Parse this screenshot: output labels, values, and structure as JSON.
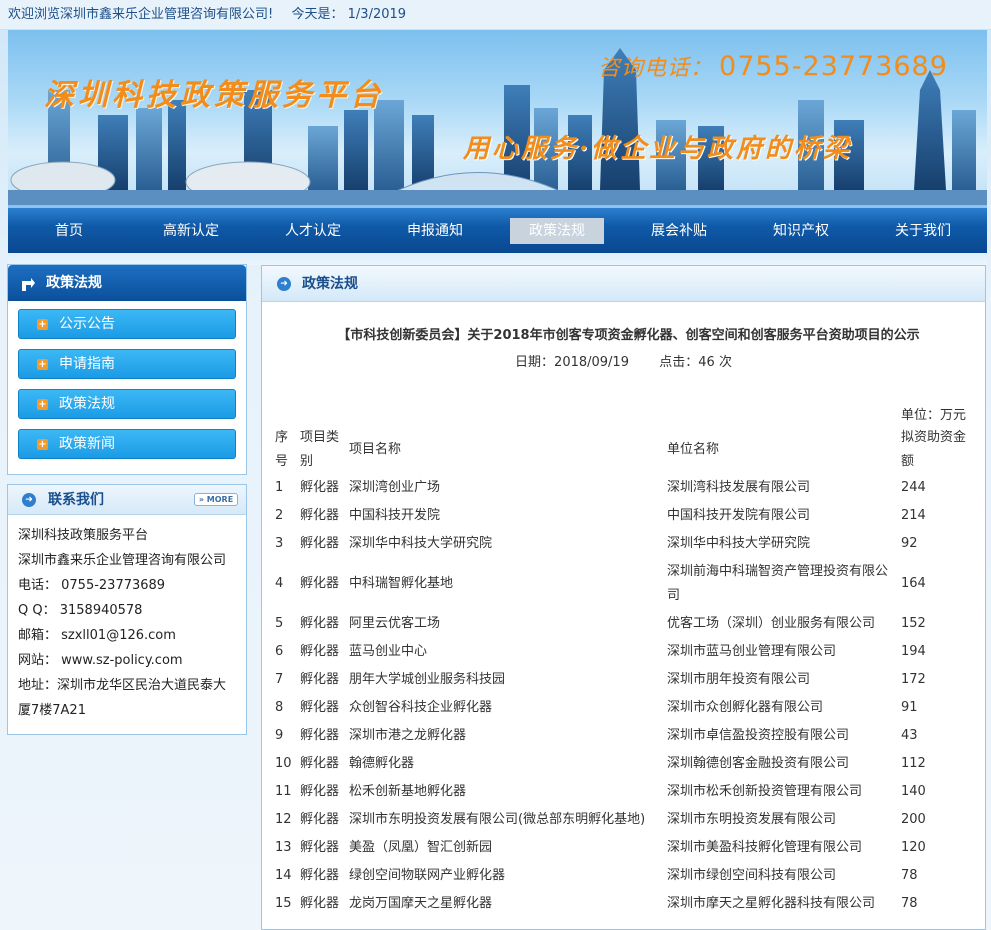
{
  "topbar": {
    "welcome": "欢迎浏览深圳市鑫来乐企业管理咨询有限公司!",
    "today_label": "今天是：",
    "today_value": "1/3/2019"
  },
  "banner": {
    "site_title": "深圳科技政策服务平台",
    "hotline_label": "咨询电话：",
    "hotline_number": "0755-23773689",
    "slogan": "用心服务·做企业与政府的桥梁"
  },
  "nav": {
    "items": [
      "首页",
      "高新认定",
      "人才认定",
      "申报通知",
      "政策法规",
      "展会补贴",
      "知识产权",
      "关于我们"
    ],
    "active": "政策法规"
  },
  "sidebar": {
    "section_title": "政策法规",
    "menu": [
      "公示公告",
      "申请指南",
      "政策法规",
      "政策新闻"
    ],
    "contact_title": "联系我们",
    "more_label": "MORE",
    "contact_lines": [
      "深圳科技政策服务平台",
      "深圳市鑫来乐企业管理咨询有限公司",
      "电话： 0755-23773689",
      "Q Q： 3158940578",
      "邮箱： szxll01@126.com",
      "网站： www.sz-policy.com",
      "地址：深圳市龙华区民治大道民泰大厦7楼7A21"
    ]
  },
  "main": {
    "panel_title": "政策法规",
    "article_title": "【市科技创新委员会】关于2018年市创客专项资金孵化器、创客空间和创客服务平台资助项目的公示",
    "date_label": "日期：",
    "date_value": "2018/09/19",
    "clicks_label": "点击：",
    "clicks_value": "46 次",
    "unit": "单位：万元",
    "table": {
      "headers": [
        "序号",
        "项目类别",
        "项目名称",
        "单位名称",
        "拟资助资金额"
      ],
      "rows": [
        [
          "1",
          "孵化器",
          "深圳湾创业广场",
          "深圳湾科技发展有限公司",
          "244"
        ],
        [
          "2",
          "孵化器",
          "中国科技开发院",
          "中国科技开发院有限公司",
          "214"
        ],
        [
          "3",
          "孵化器",
          "深圳华中科技大学研究院",
          "深圳华中科技大学研究院",
          "92"
        ],
        [
          "4",
          "孵化器",
          "中科瑞智孵化基地",
          "深圳前海中科瑞智资产管理投资有限公司",
          "164"
        ],
        [
          "5",
          "孵化器",
          "阿里云优客工场",
          "优客工场（深圳）创业服务有限公司",
          "152"
        ],
        [
          "6",
          "孵化器",
          "蓝马创业中心",
          "深圳市蓝马创业管理有限公司",
          "194"
        ],
        [
          "7",
          "孵化器",
          "朋年大学城创业服务科技园",
          "深圳市朋年投资有限公司",
          "172"
        ],
        [
          "8",
          "孵化器",
          "众创智谷科技企业孵化器",
          "深圳市众创孵化器有限公司",
          "91"
        ],
        [
          "9",
          "孵化器",
          "深圳市港之龙孵化器",
          "深圳市卓信盈投资控股有限公司",
          "43"
        ],
        [
          "10",
          "孵化器",
          "翰德孵化器",
          "深圳翰德创客金融投资有限公司",
          "112"
        ],
        [
          "11",
          "孵化器",
          "松禾创新基地孵化器",
          "深圳市松禾创新投资管理有限公司",
          "140"
        ],
        [
          "12",
          "孵化器",
          "深圳市东明投资发展有限公司(微总部东明孵化基地)",
          "深圳市东明投资发展有限公司",
          "200"
        ],
        [
          "13",
          "孵化器",
          "美盈（凤凰）智汇创新园",
          "深圳市美盈科技孵化管理有限公司",
          "120"
        ],
        [
          "14",
          "孵化器",
          "绿创空间物联网产业孵化器",
          "深圳市绿创空间科技有限公司",
          "78"
        ],
        [
          "15",
          "孵化器",
          "龙岗万国摩天之星孵化器",
          "深圳市摩天之星孵化器科技有限公司",
          "78"
        ]
      ]
    }
  },
  "colors": {
    "nav_blue": "#0f5aa8",
    "accent_orange": "#f28c1a",
    "menu_cyan": "#1b9be6"
  }
}
